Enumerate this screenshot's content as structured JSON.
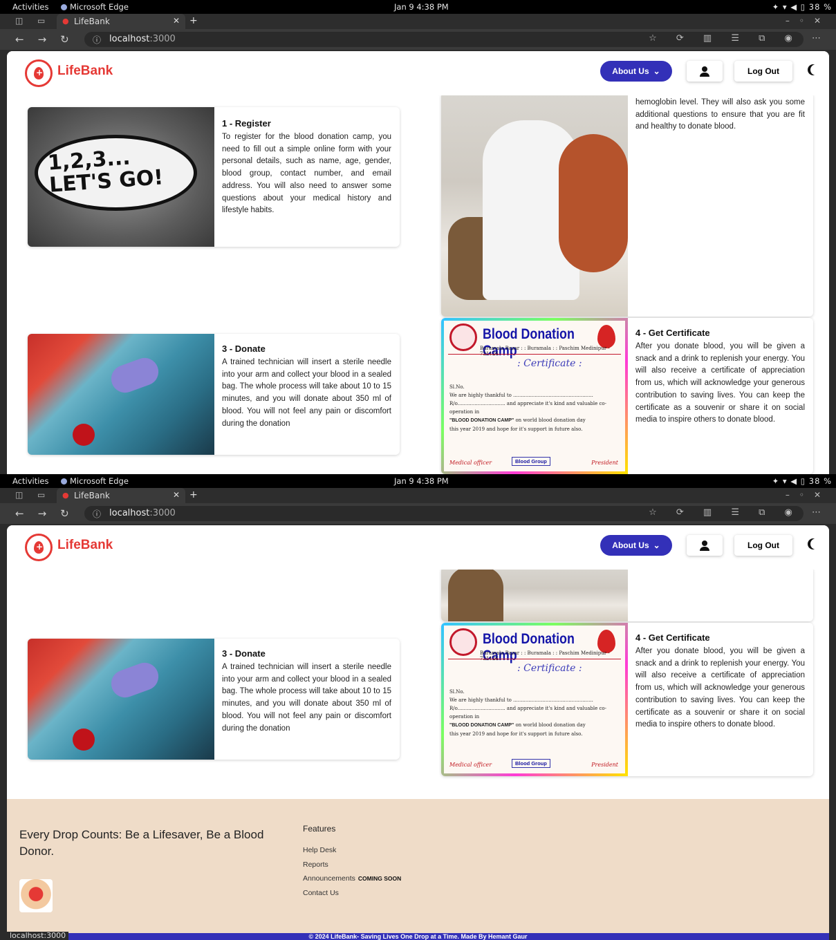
{
  "system": {
    "activities": "Activities",
    "app_name": "Microsoft Edge",
    "clock": "Jan 9  4:38 PM",
    "battery": "38 %"
  },
  "browser": {
    "tab_title": "LifeBank",
    "url_host": "localhost",
    "url_port": ":3000",
    "status_url": "localhost:3000"
  },
  "navbar": {
    "brand": "LifeBank",
    "about_label": "About Us",
    "logout_label": "Log Out"
  },
  "steps": {
    "register": {
      "title": "1 - Register",
      "text": "To register for the blood donation camp, you need to fill out a simple online form with your personal details, such as name, age, gender, blood group, contact number, and email address. You will also need to answer some questions about your medical history and lifestyle habits."
    },
    "checkup_tail": {
      "text_top": "hemoglobin level. They will also ask you some additional questions to ensure that you are fit and healthy to donate blood."
    },
    "donate": {
      "title": "3 - Donate",
      "text": "A trained technician will insert a sterile needle into your arm and collect your blood in a sealed bag. The whole process will take about 10 to 15 minutes, and you will donate about 350 ml of blood. You will not feel any pain or discomfort during the donation"
    },
    "certificate": {
      "title": "4 - Get Certificate",
      "text": "After you donate blood, you will be given a snack and a drink to replenish your energy. You will also receive a certificate of appreciation from us, which will acknowledge your generous contribution to saving lives. You can keep the certificate as a souvenir or share it on social media to inspire others to donate blood."
    }
  },
  "cert_image": {
    "title": "Blood Donation Camp",
    "address": "Buramala Bazar : : Buramala : : Paschim Medinipur - 721126",
    "subtitle": ": Certificate :",
    "sl_no": "Sl.No.",
    "line1": "We are highly thankful to ....................................................",
    "line2": "R/o............................... and appreciate it's kind and valuable co-operation in",
    "line3_bold": "\"BLOOD DONATION CAMP\"",
    "line3_rest": " on world blood donation day",
    "line4": "this year 2019 and hope for it's support in future also.",
    "medical": "Medical officer",
    "blood_group": "Blood Group",
    "president": "President"
  },
  "register_image": {
    "line1": "1,2,3...",
    "line2": "LET'S GO!"
  },
  "footer": {
    "tagline": "Every Drop Counts: Be a Lifesaver, Be a Blood Donor.",
    "features_heading": "Features",
    "links": [
      "Help Desk",
      "Reports",
      "Announcements",
      "Contact Us"
    ],
    "coming_soon": "COMING SOON",
    "copyright": "© 2024 LifeBank- Saving Lives One Drop at a Time. Made By Hemant Gaur"
  }
}
